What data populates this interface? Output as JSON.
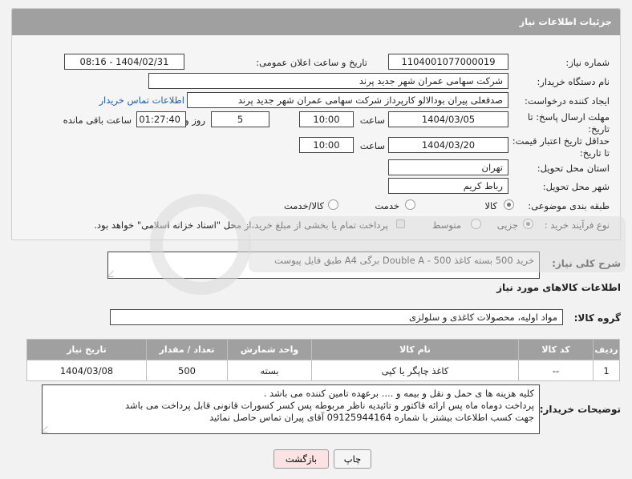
{
  "header": {
    "title": "جزئیات اطلاعات نیاز"
  },
  "form": {
    "need_number_label": "شماره نیاز:",
    "need_number": "1104001077000019",
    "announce_label": "تاریخ و ساعت اعلان عمومی:",
    "announce_value": "1404/02/31 - 08:16",
    "buyer_org_label": "نام دستگاه خریدار:",
    "buyer_org": "شرکت سهامی عمران شهر جدید پرند",
    "requester_label": "ایجاد کننده درخواست:",
    "requester": "صدقعلی پیران بودالالو کارپرداز شرکت سهامی عمران شهر جدید پرند",
    "contact_link": "اطلاعات تماس خریدار",
    "reply_deadline_label": "مهلت ارسال پاسخ: تا تاریخ:",
    "reply_date": "1404/03/05",
    "time_label": "ساعت",
    "reply_time": "10:00",
    "days_value": "5",
    "days_label": "روز و",
    "remaining_value": "01:27:40",
    "remaining_label": "ساعت باقی مانده",
    "price_validity_label": "حداقل تاریخ اعتبار قیمت: تا تاریخ:",
    "price_date": "1404/03/20",
    "price_time": "10:00",
    "province_label": "استان محل تحویل:",
    "province": "تهران",
    "city_label": "شهر محل تحویل:",
    "city": "رباط کریم",
    "category_label": "طبقه بندی موضوعی:",
    "category_options": [
      "کالا",
      "خدمت",
      "کالا/خدمت"
    ],
    "process_label": "نوع فرآیند خرید :",
    "process_options": [
      "جزیی",
      "متوسط"
    ],
    "payment_note": "پرداخت تمام یا بخشی از مبلغ خرید،از محل \"اسناد خزانه اسلامی\" خواهد بود."
  },
  "summary": {
    "label": "شرح کلی نیاز:",
    "text": "خرید 500 بسته کاغذ Double A - 500 برگی A4 طبق فایل پیوست"
  },
  "goods": {
    "section_title": "اطلاعات کالاهای مورد نیاز",
    "group_label": "گروه کالا:",
    "group_value": "مواد اولیه، محصولات کاغذی و سلولزی",
    "columns": [
      "ردیف",
      "کد کالا",
      "نام کالا",
      "واحد شمارش",
      "تعداد / مقدار",
      "تاریخ نیاز"
    ],
    "rows": [
      {
        "row": "1",
        "code": "--",
        "name": "کاغذ چاپگر یا کپی",
        "unit": "بسته",
        "qty": "500",
        "date": "1404/03/08"
      }
    ]
  },
  "notes": {
    "label": "توضیحات خریدار:",
    "line1": "کلیه هزینه ها ی حمل و نقل و بیمه و .... برعهده تامین کننده می باشد .",
    "line2": "پرداخت دوماه ماه پس ارائه فاکتور و تائیدیه ناظر مربوطه پس کسر کسورات قانونی قابل پرداخت می باشد",
    "line3": "جهت کسب اطلاعات بیشتر با شماره 09125944164 آقای پیران تماس حاصل نمائید"
  },
  "buttons": {
    "print": "چاپ",
    "back": "بازگشت"
  },
  "colors": {
    "header_bg": "#a0a0a0",
    "link": "#1a5fb4",
    "back_button_bg": "#fbe3e3"
  }
}
